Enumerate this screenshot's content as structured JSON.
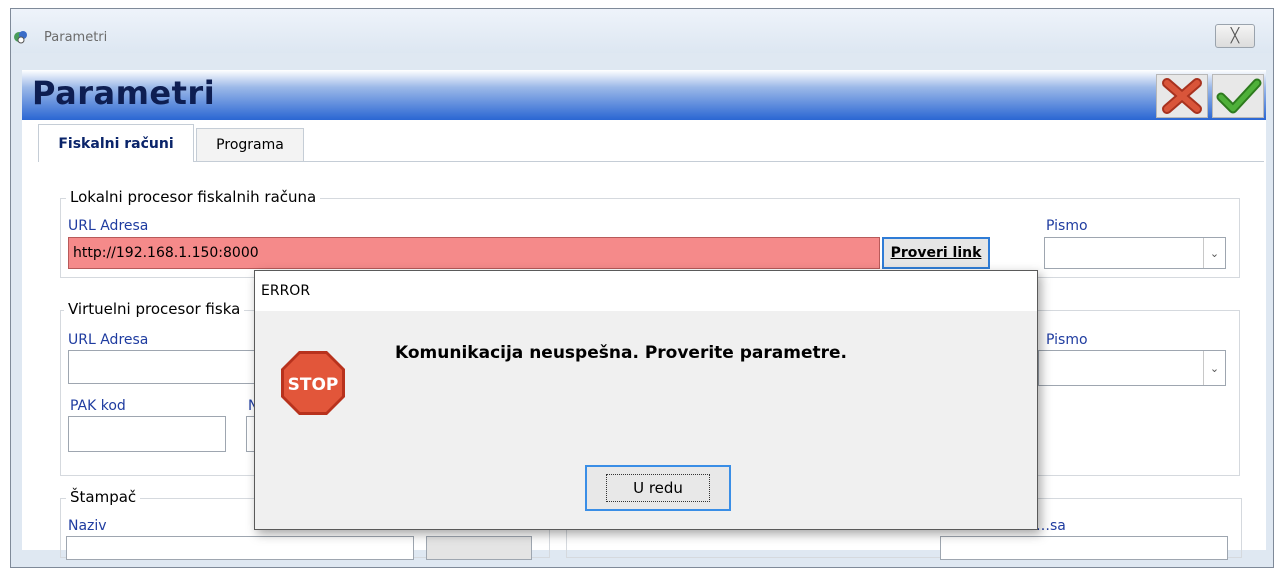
{
  "window": {
    "title": "Parametri",
    "close_glyph": "╳"
  },
  "header": {
    "title": "Parametri"
  },
  "tabs": [
    {
      "label": "Fiskalni računi",
      "active": true
    },
    {
      "label": "Programa",
      "active": false
    }
  ],
  "lokalni": {
    "legend": "Lokalni procesor fiskalnih računa",
    "url_label": "URL Adresa",
    "url_value": "http://192.168.1.150:8000",
    "check_button": "Proveri link",
    "pismo_label": "Pismo",
    "pismo_value": ""
  },
  "virtuelni": {
    "legend": "Virtuelni procesor fiska",
    "url_label": "URL Adresa",
    "url_value": "",
    "pak_label": "PAK kod",
    "pak_value": "",
    "second_label_partial": "N",
    "pismo_label": "Pismo",
    "pismo_value": ""
  },
  "stampac": {
    "legend": "Štampač",
    "naziv_label": "Naziv",
    "email_label_partial": "…sa"
  },
  "dialog": {
    "title": "ERROR",
    "message": "Komunikacija neuspešna. Proverite parametre.",
    "icon_text": "STOP",
    "ok_button": "U redu"
  },
  "icons": {
    "app": "app-icon",
    "cancel": "red-x-icon",
    "confirm": "green-check-icon",
    "stop": "stop-sign-icon",
    "dropdown": "chevron-down-icon"
  },
  "colors": {
    "error_field": "#f58a8a",
    "header_blue": "#2a66d3",
    "stop_red": "#e0452c",
    "confirm_green": "#3c9a2a"
  }
}
